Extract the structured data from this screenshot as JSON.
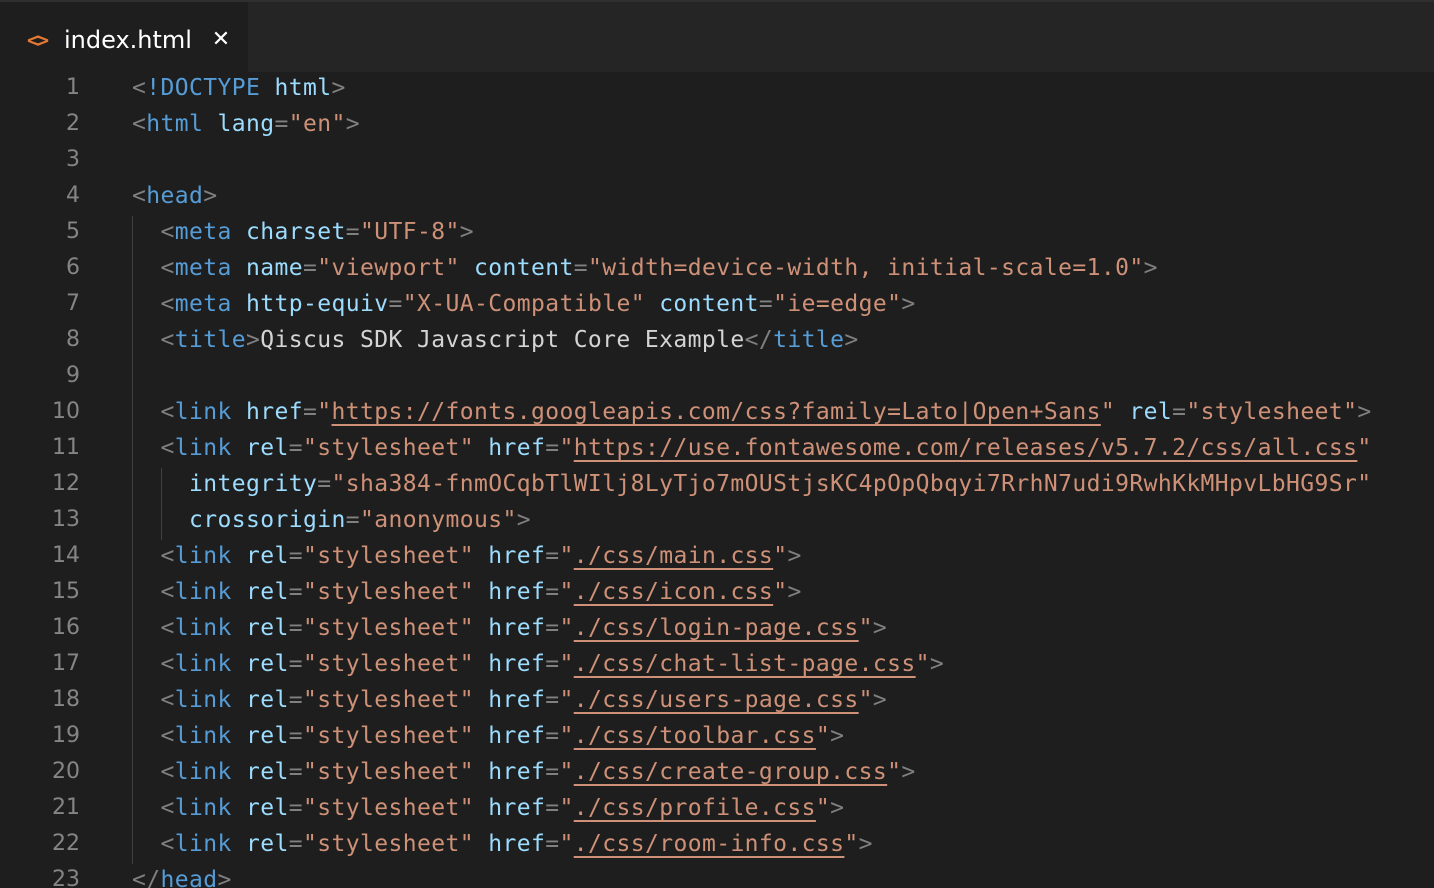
{
  "tab": {
    "icon": "code-brackets-icon",
    "label": "index.html",
    "close_glyph": "✕"
  },
  "colors": {
    "background": "#1e1e1e",
    "tag": "#569cd6",
    "attribute": "#9cdcfe",
    "string": "#ce9178",
    "punctuation": "#808080",
    "text": "#d4d4d4",
    "line_number": "#858585",
    "icon": "#e37933"
  },
  "lines": [
    {
      "n": "1",
      "tokens": [
        [
          "p",
          "<"
        ],
        [
          "t",
          "!DOCTYPE"
        ],
        [
          "tx",
          " "
        ],
        [
          "a",
          "html"
        ],
        [
          "p",
          ">"
        ]
      ]
    },
    {
      "n": "2",
      "tokens": [
        [
          "p",
          "<"
        ],
        [
          "t",
          "html"
        ],
        [
          "tx",
          " "
        ],
        [
          "a",
          "lang"
        ],
        [
          "p",
          "="
        ],
        [
          "s",
          "\"en\""
        ],
        [
          "p",
          ">"
        ]
      ]
    },
    {
      "n": "3",
      "tokens": []
    },
    {
      "n": "4",
      "tokens": [
        [
          "p",
          "<"
        ],
        [
          "t",
          "head"
        ],
        [
          "p",
          ">"
        ]
      ]
    },
    {
      "n": "5",
      "tokens": [
        [
          "tx",
          "  "
        ],
        [
          "p",
          "<"
        ],
        [
          "t",
          "meta"
        ],
        [
          "tx",
          " "
        ],
        [
          "a",
          "charset"
        ],
        [
          "p",
          "="
        ],
        [
          "s",
          "\"UTF-8\""
        ],
        [
          "p",
          ">"
        ]
      ]
    },
    {
      "n": "6",
      "tokens": [
        [
          "tx",
          "  "
        ],
        [
          "p",
          "<"
        ],
        [
          "t",
          "meta"
        ],
        [
          "tx",
          " "
        ],
        [
          "a",
          "name"
        ],
        [
          "p",
          "="
        ],
        [
          "s",
          "\"viewport\""
        ],
        [
          "tx",
          " "
        ],
        [
          "a",
          "content"
        ],
        [
          "p",
          "="
        ],
        [
          "s",
          "\"width=device-width, initial-scale=1.0\""
        ],
        [
          "p",
          ">"
        ]
      ]
    },
    {
      "n": "7",
      "tokens": [
        [
          "tx",
          "  "
        ],
        [
          "p",
          "<"
        ],
        [
          "t",
          "meta"
        ],
        [
          "tx",
          " "
        ],
        [
          "a",
          "http-equiv"
        ],
        [
          "p",
          "="
        ],
        [
          "s",
          "\"X-UA-Compatible\""
        ],
        [
          "tx",
          " "
        ],
        [
          "a",
          "content"
        ],
        [
          "p",
          "="
        ],
        [
          "s",
          "\"ie=edge\""
        ],
        [
          "p",
          ">"
        ]
      ]
    },
    {
      "n": "8",
      "tokens": [
        [
          "tx",
          "  "
        ],
        [
          "p",
          "<"
        ],
        [
          "t",
          "title"
        ],
        [
          "p",
          ">"
        ],
        [
          "tx",
          "Qiscus SDK Javascript Core Example"
        ],
        [
          "p",
          "</"
        ],
        [
          "t",
          "title"
        ],
        [
          "p",
          ">"
        ]
      ]
    },
    {
      "n": "9",
      "tokens": []
    },
    {
      "n": "10",
      "tokens": [
        [
          "tx",
          "  "
        ],
        [
          "p",
          "<"
        ],
        [
          "t",
          "link"
        ],
        [
          "tx",
          " "
        ],
        [
          "a",
          "href"
        ],
        [
          "p",
          "="
        ],
        [
          "s",
          "\""
        ],
        [
          "su",
          "https://fonts.googleapis.com/css?family=Lato|Open+Sans"
        ],
        [
          "s",
          "\""
        ],
        [
          "tx",
          " "
        ],
        [
          "a",
          "rel"
        ],
        [
          "p",
          "="
        ],
        [
          "s",
          "\"stylesheet\""
        ],
        [
          "p",
          ">"
        ]
      ]
    },
    {
      "n": "11",
      "tokens": [
        [
          "tx",
          "  "
        ],
        [
          "p",
          "<"
        ],
        [
          "t",
          "link"
        ],
        [
          "tx",
          " "
        ],
        [
          "a",
          "rel"
        ],
        [
          "p",
          "="
        ],
        [
          "s",
          "\"stylesheet\""
        ],
        [
          "tx",
          " "
        ],
        [
          "a",
          "href"
        ],
        [
          "p",
          "="
        ],
        [
          "s",
          "\""
        ],
        [
          "su",
          "https://use.fontawesome.com/releases/v5.7.2/css/all.css"
        ],
        [
          "s",
          "\""
        ]
      ]
    },
    {
      "n": "12",
      "tokens": [
        [
          "tx",
          "    "
        ],
        [
          "a",
          "integrity"
        ],
        [
          "p",
          "="
        ],
        [
          "s",
          "\"sha384-fnmOCqbTlWIlj8LyTjo7mOUStjsKC4pOpQbqyi7RrhN7udi9RwhKkMHpvLbHG9Sr\""
        ]
      ]
    },
    {
      "n": "13",
      "tokens": [
        [
          "tx",
          "    "
        ],
        [
          "a",
          "crossorigin"
        ],
        [
          "p",
          "="
        ],
        [
          "s",
          "\"anonymous\""
        ],
        [
          "p",
          ">"
        ]
      ]
    },
    {
      "n": "14",
      "tokens": [
        [
          "tx",
          "  "
        ],
        [
          "p",
          "<"
        ],
        [
          "t",
          "link"
        ],
        [
          "tx",
          " "
        ],
        [
          "a",
          "rel"
        ],
        [
          "p",
          "="
        ],
        [
          "s",
          "\"stylesheet\""
        ],
        [
          "tx",
          " "
        ],
        [
          "a",
          "href"
        ],
        [
          "p",
          "="
        ],
        [
          "s",
          "\""
        ],
        [
          "su",
          "./css/main.css"
        ],
        [
          "s",
          "\""
        ],
        [
          "p",
          ">"
        ]
      ]
    },
    {
      "n": "15",
      "tokens": [
        [
          "tx",
          "  "
        ],
        [
          "p",
          "<"
        ],
        [
          "t",
          "link"
        ],
        [
          "tx",
          " "
        ],
        [
          "a",
          "rel"
        ],
        [
          "p",
          "="
        ],
        [
          "s",
          "\"stylesheet\""
        ],
        [
          "tx",
          " "
        ],
        [
          "a",
          "href"
        ],
        [
          "p",
          "="
        ],
        [
          "s",
          "\""
        ],
        [
          "su",
          "./css/icon.css"
        ],
        [
          "s",
          "\""
        ],
        [
          "p",
          ">"
        ]
      ]
    },
    {
      "n": "16",
      "tokens": [
        [
          "tx",
          "  "
        ],
        [
          "p",
          "<"
        ],
        [
          "t",
          "link"
        ],
        [
          "tx",
          " "
        ],
        [
          "a",
          "rel"
        ],
        [
          "p",
          "="
        ],
        [
          "s",
          "\"stylesheet\""
        ],
        [
          "tx",
          " "
        ],
        [
          "a",
          "href"
        ],
        [
          "p",
          "="
        ],
        [
          "s",
          "\""
        ],
        [
          "su",
          "./css/login-page.css"
        ],
        [
          "s",
          "\""
        ],
        [
          "p",
          ">"
        ]
      ]
    },
    {
      "n": "17",
      "tokens": [
        [
          "tx",
          "  "
        ],
        [
          "p",
          "<"
        ],
        [
          "t",
          "link"
        ],
        [
          "tx",
          " "
        ],
        [
          "a",
          "rel"
        ],
        [
          "p",
          "="
        ],
        [
          "s",
          "\"stylesheet\""
        ],
        [
          "tx",
          " "
        ],
        [
          "a",
          "href"
        ],
        [
          "p",
          "="
        ],
        [
          "s",
          "\""
        ],
        [
          "su",
          "./css/chat-list-page.css"
        ],
        [
          "s",
          "\""
        ],
        [
          "p",
          ">"
        ]
      ]
    },
    {
      "n": "18",
      "tokens": [
        [
          "tx",
          "  "
        ],
        [
          "p",
          "<"
        ],
        [
          "t",
          "link"
        ],
        [
          "tx",
          " "
        ],
        [
          "a",
          "rel"
        ],
        [
          "p",
          "="
        ],
        [
          "s",
          "\"stylesheet\""
        ],
        [
          "tx",
          " "
        ],
        [
          "a",
          "href"
        ],
        [
          "p",
          "="
        ],
        [
          "s",
          "\""
        ],
        [
          "su",
          "./css/users-page.css"
        ],
        [
          "s",
          "\""
        ],
        [
          "p",
          ">"
        ]
      ]
    },
    {
      "n": "19",
      "tokens": [
        [
          "tx",
          "  "
        ],
        [
          "p",
          "<"
        ],
        [
          "t",
          "link"
        ],
        [
          "tx",
          " "
        ],
        [
          "a",
          "rel"
        ],
        [
          "p",
          "="
        ],
        [
          "s",
          "\"stylesheet\""
        ],
        [
          "tx",
          " "
        ],
        [
          "a",
          "href"
        ],
        [
          "p",
          "="
        ],
        [
          "s",
          "\""
        ],
        [
          "su",
          "./css/toolbar.css"
        ],
        [
          "s",
          "\""
        ],
        [
          "p",
          ">"
        ]
      ]
    },
    {
      "n": "20",
      "tokens": [
        [
          "tx",
          "  "
        ],
        [
          "p",
          "<"
        ],
        [
          "t",
          "link"
        ],
        [
          "tx",
          " "
        ],
        [
          "a",
          "rel"
        ],
        [
          "p",
          "="
        ],
        [
          "s",
          "\"stylesheet\""
        ],
        [
          "tx",
          " "
        ],
        [
          "a",
          "href"
        ],
        [
          "p",
          "="
        ],
        [
          "s",
          "\""
        ],
        [
          "su",
          "./css/create-group.css"
        ],
        [
          "s",
          "\""
        ],
        [
          "p",
          ">"
        ]
      ]
    },
    {
      "n": "21",
      "tokens": [
        [
          "tx",
          "  "
        ],
        [
          "p",
          "<"
        ],
        [
          "t",
          "link"
        ],
        [
          "tx",
          " "
        ],
        [
          "a",
          "rel"
        ],
        [
          "p",
          "="
        ],
        [
          "s",
          "\"stylesheet\""
        ],
        [
          "tx",
          " "
        ],
        [
          "a",
          "href"
        ],
        [
          "p",
          "="
        ],
        [
          "s",
          "\""
        ],
        [
          "su",
          "./css/profile.css"
        ],
        [
          "s",
          "\""
        ],
        [
          "p",
          ">"
        ]
      ]
    },
    {
      "n": "22",
      "tokens": [
        [
          "tx",
          "  "
        ],
        [
          "p",
          "<"
        ],
        [
          "t",
          "link"
        ],
        [
          "tx",
          " "
        ],
        [
          "a",
          "rel"
        ],
        [
          "p",
          "="
        ],
        [
          "s",
          "\"stylesheet\""
        ],
        [
          "tx",
          " "
        ],
        [
          "a",
          "href"
        ],
        [
          "p",
          "="
        ],
        [
          "s",
          "\""
        ],
        [
          "su",
          "./css/room-info.css"
        ],
        [
          "s",
          "\""
        ],
        [
          "p",
          ">"
        ]
      ]
    },
    {
      "n": "23",
      "tokens": [
        [
          "p",
          "</"
        ],
        [
          "t",
          "head"
        ],
        [
          "p",
          ">"
        ]
      ]
    }
  ]
}
